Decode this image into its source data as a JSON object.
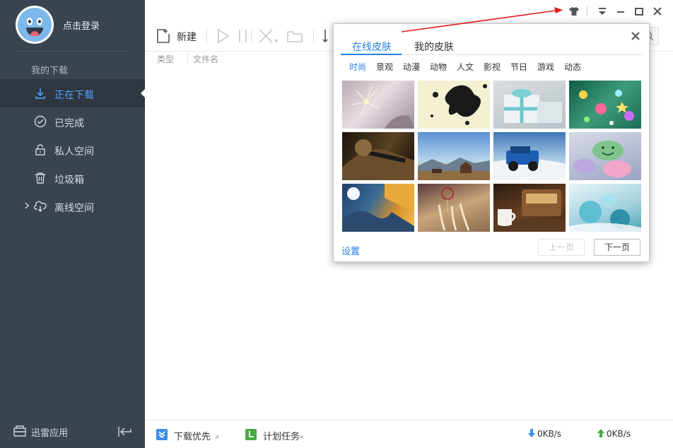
{
  "sidebar": {
    "login_label": "点击登录",
    "section_label": "我的下载",
    "items": [
      {
        "label": "正在下载",
        "icon": "download-icon",
        "active": true
      },
      {
        "label": "已完成",
        "icon": "check-circle-icon"
      },
      {
        "label": "私人空间",
        "icon": "lock-icon"
      },
      {
        "label": "垃圾箱",
        "icon": "trash-icon"
      },
      {
        "label": "离线空间",
        "icon": "cloud-download-icon"
      }
    ],
    "apps_label": "迅雷应用"
  },
  "toolbar": {
    "new_label": "新建"
  },
  "columns": {
    "type": "类型",
    "name": "文件名"
  },
  "statusbar": {
    "priority_label": "下载优先",
    "schedule_label": "计划任务",
    "down_speed": "0KB/s",
    "up_speed": "0KB/s"
  },
  "skin_popup": {
    "tabs": [
      "在线皮肤",
      "我的皮肤"
    ],
    "active_tab": 0,
    "categories": [
      "时尚",
      "景观",
      "动漫",
      "动物",
      "人文",
      "影视",
      "节日",
      "游戏",
      "动态"
    ],
    "active_category": 0,
    "settings_label": "设置",
    "prev_label": "上一页",
    "next_label": "下一页"
  },
  "colors": {
    "sidebar_bg": "#3a4450",
    "accent": "#2b7fe0",
    "active_nav": "#4fa3ff"
  }
}
